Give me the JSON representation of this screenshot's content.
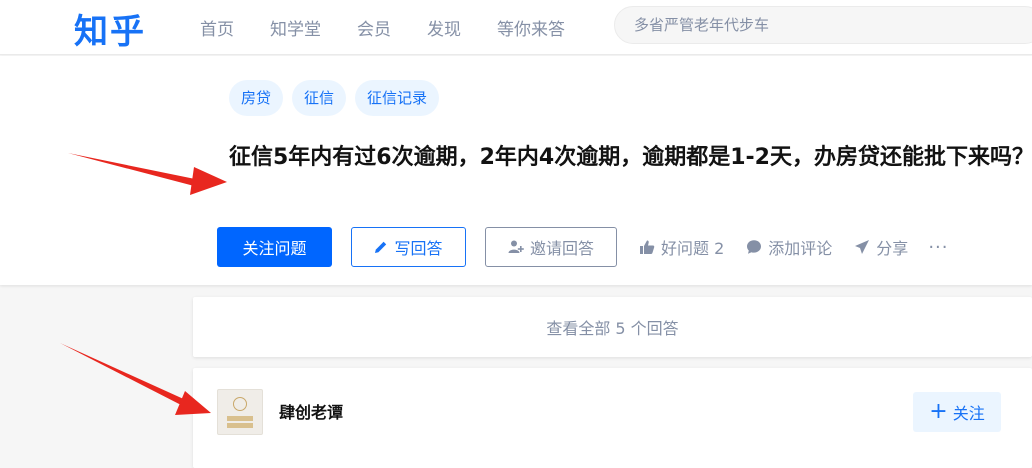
{
  "header": {
    "logo": "知乎",
    "nav": [
      "首页",
      "知学堂",
      "会员",
      "发现",
      "等你来答"
    ],
    "search_placeholder": "多省严管老年代步车"
  },
  "question": {
    "tags": [
      "房贷",
      "征信",
      "征信记录"
    ],
    "title": "征信5年内有过6次逾期，2年内4次逾期，逾期都是1-2天，办房贷还能批下来吗？",
    "follow_label": "关注问题",
    "write_label": "写回答",
    "invite_label": "邀请回答",
    "good_label": "好问题 2",
    "comment_label": "添加评论",
    "share_label": "分享",
    "more_label": "···"
  },
  "answers": {
    "view_all_label": "查看全部 5 个回答"
  },
  "answer": {
    "author": "肆创老谭",
    "follow_label": "关注"
  },
  "colors": {
    "brand": "#1772f6",
    "primary_button": "#0066ff",
    "annotation_arrow": "#e8271f"
  }
}
